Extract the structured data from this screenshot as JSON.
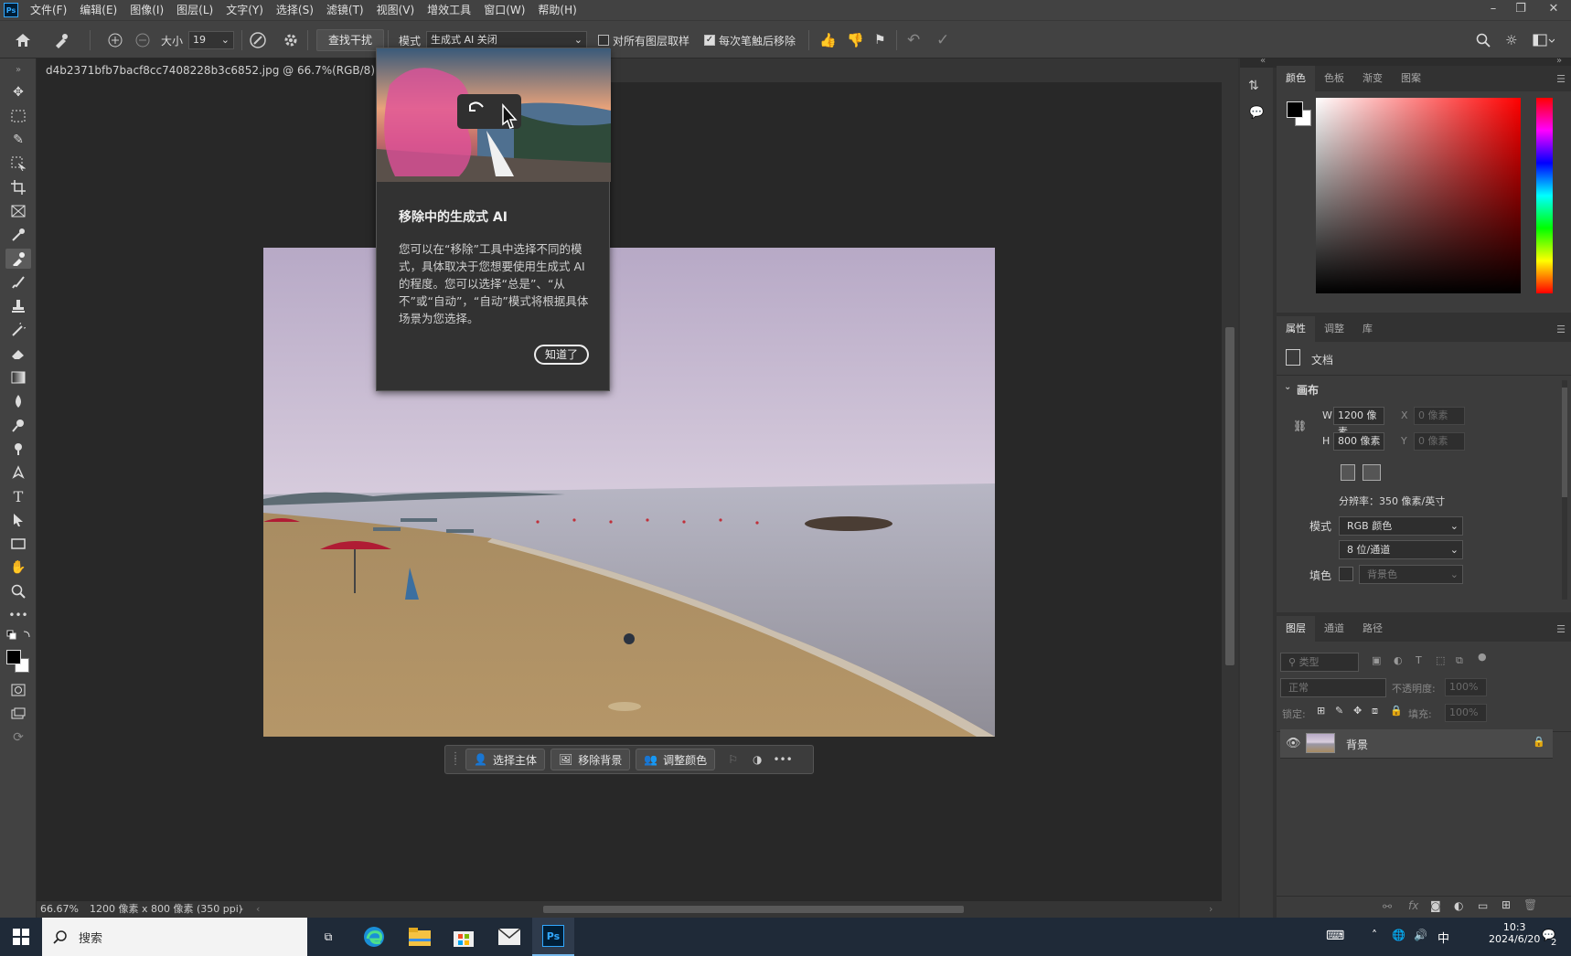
{
  "app": {
    "logo": "Ps"
  },
  "menubar": {
    "items": [
      "文件(F)",
      "编辑(E)",
      "图像(I)",
      "图层(L)",
      "文字(Y)",
      "选择(S)",
      "滤镜(T)",
      "视图(V)",
      "增效工具",
      "窗口(W)",
      "帮助(H)"
    ]
  },
  "options": {
    "size_label": "大小",
    "size_value": "19",
    "find_distractions": "查找干扰",
    "mode_label": "模式",
    "mode_value": "生成式 AI 关闭",
    "sample_all_layers": "对所有图层取样",
    "remove_after_stroke": "每次笔触后移除"
  },
  "document": {
    "tab_title": "d4b2371bfb7bacf8cc7408228b3c6852.jpg @ 66.7%(RGB/8) *",
    "tab_close": "×"
  },
  "popover": {
    "title": "移除中的生成式 AI",
    "body": "您可以在“移除”工具中选择不同的模式，具体取决于您想要使用生成式 AI 的程度。您可以选择“总是”、“从不”或“自动”，“自动”模式将根据具体场景为您选择。",
    "ok": "知道了"
  },
  "contextbar": {
    "select_subject": "选择主体",
    "remove_bg": "移除背景",
    "adjust_color": "调整颜色",
    "more": "•••"
  },
  "status": {
    "zoom": "66.67%",
    "info": "1200 像素 x 800 像素 (350 ppi)"
  },
  "color_panel": {
    "tabs": [
      "颜色",
      "色板",
      "渐变",
      "图案"
    ]
  },
  "properties_panel": {
    "tabs": [
      "属性",
      "调整",
      "库"
    ],
    "doc_label": "文档",
    "canvas_header": "画布",
    "w_label": "W",
    "w_value": "1200 像素",
    "h_label": "H",
    "h_value": "800 像素",
    "x_label": "X",
    "x_value": "0 像素",
    "y_label": "Y",
    "y_value": "0 像素",
    "resolution": "分辨率：350 像素/英寸",
    "mode_label": "模式",
    "mode_value": "RGB 颜色",
    "depth_value": "8 位/通道",
    "fill_label": "填色",
    "fill_value": "背景色"
  },
  "layers_panel": {
    "tabs": [
      "图层",
      "通道",
      "路径"
    ],
    "filter_placeholder": "类型",
    "blend_mode": "正常",
    "opacity_label": "不透明度:",
    "opacity_value": "100%",
    "lock_label": "锁定:",
    "fill_label": "填充:",
    "fill_value": "100%",
    "layer_name": "背景"
  },
  "taskbar": {
    "search_placeholder": "搜索",
    "time": "10:3",
    "date": "2024/6/20",
    "ime": "中",
    "ime_badge": "2"
  },
  "colors": {
    "accent": "#31a8ff",
    "selection_overlay": "#e0509a"
  }
}
